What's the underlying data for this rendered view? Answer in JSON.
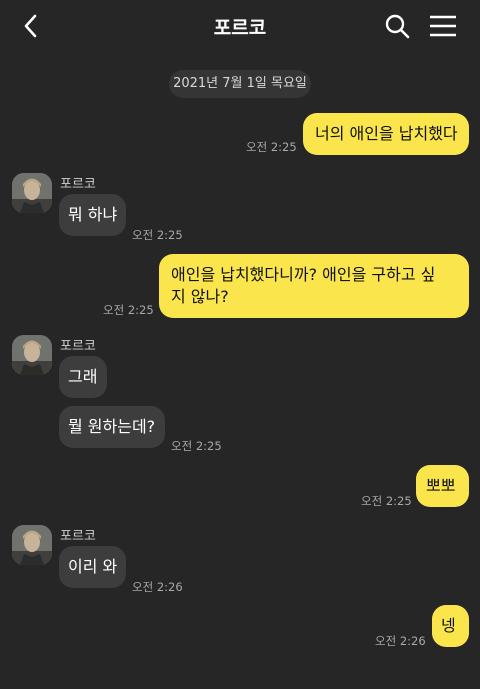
{
  "header": {
    "title": "포르코",
    "back_icon": "chevron-left-icon",
    "search_icon": "search-icon",
    "menu_icon": "hamburger-menu-icon"
  },
  "date_divider": "2021년 7월 1일 목요일",
  "messages": [
    {
      "from": "me",
      "text": "너의 애인을 납치했다",
      "time": "오전 2:25"
    },
    {
      "from": "other",
      "sender": "포르코",
      "text": "뭐 하냐",
      "time": "오전 2:25"
    },
    {
      "from": "me",
      "text_line1": "애인을 납치했다니까? 애인을 구하고 싶",
      "text_line2": "지 않나?",
      "time": "오전 2:25"
    },
    {
      "from": "other",
      "sender": "포르코",
      "text": "그래"
    },
    {
      "from": "other",
      "text": "뭘 원하는데?",
      "time": "오전 2:25"
    },
    {
      "from": "me",
      "text": "뽀뽀",
      "time": "오전 2:25"
    },
    {
      "from": "other",
      "sender": "포르코",
      "text": "이리 와",
      "time": "오전 2:26"
    },
    {
      "from": "me",
      "text": "넹",
      "time": "오전 2:26"
    }
  ],
  "colors": {
    "background": "#262626",
    "my_bubble": "#fae64c",
    "their_bubble": "#3d3d3d"
  }
}
